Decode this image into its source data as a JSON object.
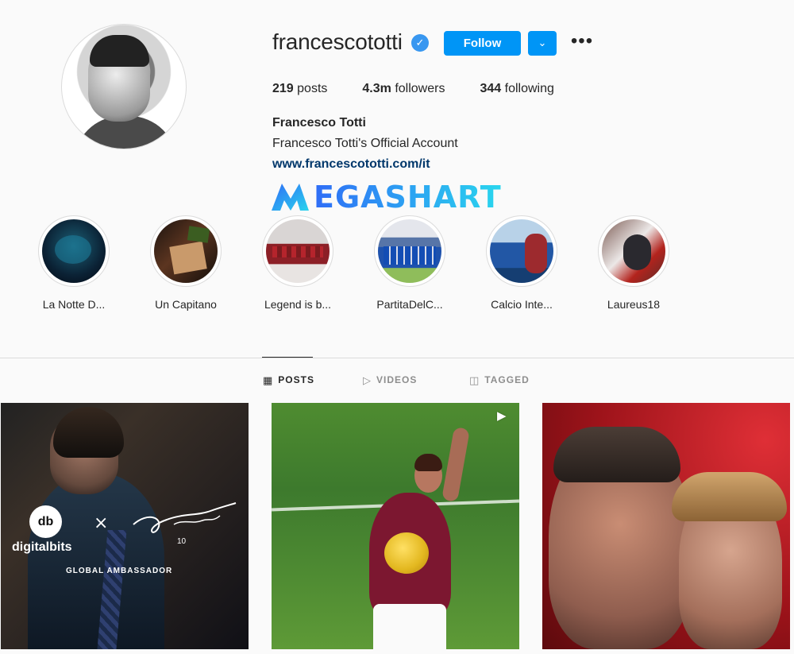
{
  "profile": {
    "username": "francescototti",
    "verified_badge": "✓",
    "follow_label": "Follow",
    "dropdown_icon": "chevron-down",
    "more_label": "•••",
    "stats": {
      "posts_value": "219",
      "posts_label": "posts",
      "followers_value": "4.3m",
      "followers_label": "followers",
      "following_value": "344",
      "following_label": "following"
    },
    "full_name": "Francesco Totti",
    "bio": "Francesco Totti's Official Account",
    "website": "www.francescototti.com/it"
  },
  "watermark": {
    "text": "EGASHART",
    "mark": "M"
  },
  "highlights": [
    {
      "label": "La Notte D..."
    },
    {
      "label": "Un Capitano"
    },
    {
      "label": "Legend is b..."
    },
    {
      "label": "PartitaDelC..."
    },
    {
      "label": "Calcio Inte..."
    },
    {
      "label": "Laureus18"
    }
  ],
  "tabs": [
    {
      "label": "POSTS",
      "icon": "▦"
    },
    {
      "label": "VIDEOS",
      "icon": "▷"
    },
    {
      "label": "TAGGED",
      "icon": "◫"
    }
  ],
  "posts": [
    {
      "brand": "digitalbits",
      "logo_text": "db",
      "separator": "×",
      "caption": "GLOBAL AMBASSADOR",
      "signature_number": "10"
    },
    {
      "video_icon": "▶"
    },
    {}
  ],
  "colors": {
    "accent": "#0095f6",
    "verified": "#3897f0",
    "link": "#00376b",
    "divider": "#dbdbdb"
  }
}
